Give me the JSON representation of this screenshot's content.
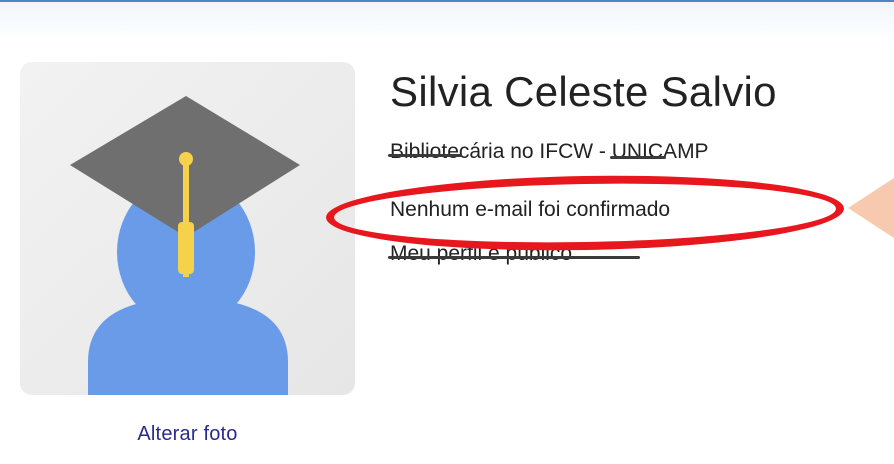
{
  "profile": {
    "name": "Silvia Celeste Salvio",
    "affiliation": "Bibliotecária no IFCW - UNICAMP",
    "email_status": "Nenhum e-mail foi confirmado",
    "visibility": "Meu perfil é público"
  },
  "avatar": {
    "icon": "graduate-cap-avatar-icon",
    "change_photo_label": "Alterar foto"
  },
  "annotation": {
    "ellipse_color": "#e8171d",
    "arrow_color": "#f6bfa0"
  }
}
